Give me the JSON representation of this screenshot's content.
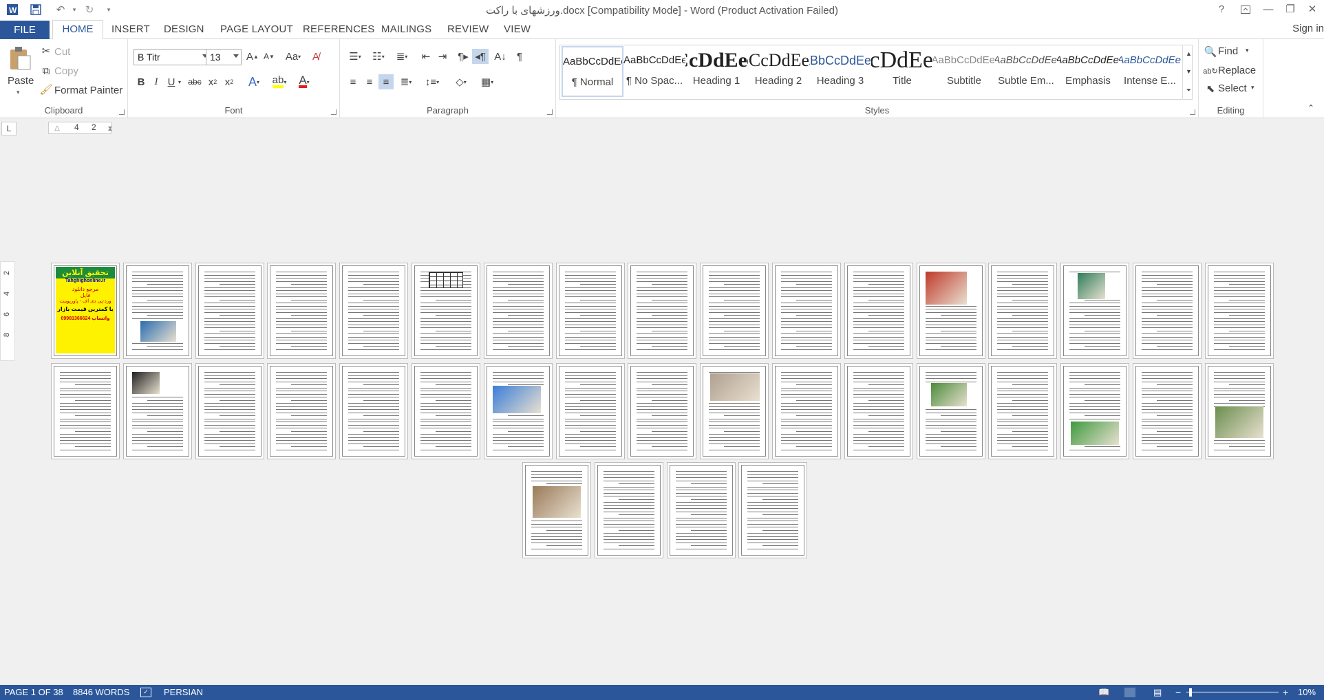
{
  "title": "ورزشهای با راکت.docx [Compatibility Mode] - Word (Product Activation Failed)",
  "window_controls": {
    "help": "?",
    "min": "—",
    "restore": "❐",
    "close": "✕"
  },
  "tabs": {
    "file": "FILE",
    "home": "HOME",
    "insert": "INSERT",
    "design": "DESIGN",
    "page_layout": "PAGE LAYOUT",
    "references": "REFERENCES",
    "mailings": "MAILINGS",
    "review": "REVIEW",
    "view": "VIEW"
  },
  "signin": "Sign in",
  "clipboard": {
    "paste": "Paste",
    "cut": "Cut",
    "copy": "Copy",
    "format_painter": "Format Painter",
    "label": "Clipboard"
  },
  "font": {
    "name": "B Titr",
    "size": "13",
    "label": "Font",
    "case_btn": "Aa"
  },
  "paragraph": {
    "label": "Paragraph"
  },
  "styles": {
    "label": "Styles",
    "items": [
      {
        "preview": "AaBbCcDdEe",
        "name": "¶ Normal"
      },
      {
        "preview": "AaBbCcDdEe",
        "name": "¶ No Spac..."
      },
      {
        "preview": "AaBbCcDdEe",
        "name": "Heading 1"
      },
      {
        "preview": "AaBbCcDdEe",
        "name": "Heading 2"
      },
      {
        "preview": "AaBbCcDdEe",
        "name": "Heading 3"
      },
      {
        "preview": "AaBbCcDdEe",
        "name": "Title"
      },
      {
        "preview": "AaBbCcDdEe",
        "name": "Subtitle"
      },
      {
        "preview": "AaBbCcDdEe",
        "name": "Subtle Em..."
      },
      {
        "preview": "AaBbCcDdEe",
        "name": "Emphasis"
      },
      {
        "preview": "AaBbCcDdEe",
        "name": "Intense E..."
      }
    ]
  },
  "editing": {
    "find": "Find",
    "replace": "Replace",
    "select": "Select",
    "label": "Editing"
  },
  "ruler": {
    "tab": "L",
    "n1": "4",
    "n2": "2"
  },
  "vruler": [
    "2",
    "4",
    "6",
    "8"
  ],
  "cover_page": {
    "l1": "تحقیق آنلاین",
    "l2": "Tahghighonline.ir",
    "l3": "مرجع دانلود",
    "l4": "فایل",
    "l5": "ورد-پی دی اف - پاورپوینت",
    "l6": "با کمترین قیمت بازار",
    "l7": "09981366624 واتساپ"
  },
  "status": {
    "page": "PAGE 1 OF 38",
    "words": "8846 WORDS",
    "lang": "PERSIAN",
    "zoom": "10%"
  },
  "colors": {
    "accent": "#2b579a",
    "status_bg": "#2b579a"
  }
}
